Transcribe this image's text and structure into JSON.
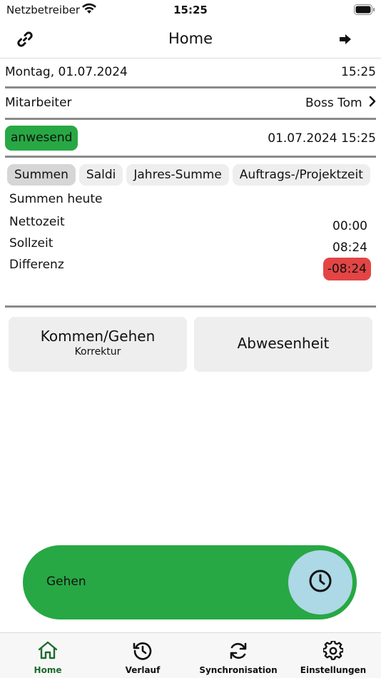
{
  "status_bar": {
    "carrier": "Netzbetreiber",
    "time": "15:25"
  },
  "nav": {
    "title": "Home"
  },
  "date_row": {
    "date": "Montag, 01.07.2024",
    "time": "15:25"
  },
  "employee_row": {
    "label": "Mitarbeiter",
    "value": "Boss Tom"
  },
  "status_row": {
    "badge": "anwesend",
    "timestamp": "01.07.2024 15:25",
    "badge_color": "#27a844"
  },
  "tabs": [
    {
      "label": "Summen"
    },
    {
      "label": "Saldi"
    },
    {
      "label": "Jahres-Summe"
    },
    {
      "label": "Auftrags-/Projektzeit"
    }
  ],
  "summary": {
    "title": "Summen heute",
    "rows": [
      {
        "label": "Nettozeit",
        "value": "00:00"
      },
      {
        "label": "Sollzeit",
        "value": "08:24"
      },
      {
        "label": "Differenz",
        "value": "-08:24"
      }
    ],
    "negative_color": "#e34545"
  },
  "buttons": {
    "kommen_gehen": {
      "label": "Kommen/Gehen",
      "sub": "Korrektur"
    },
    "abwesenheit": {
      "label": "Abwesenheit"
    }
  },
  "slider": {
    "label": "Gehen",
    "color": "#27a844",
    "knob_color": "#add8e6"
  },
  "tabbar": {
    "items": [
      {
        "label": "Home",
        "icon": "home-icon"
      },
      {
        "label": "Verlauf",
        "icon": "history-icon"
      },
      {
        "label": "Synchronisation",
        "icon": "sync-icon"
      },
      {
        "label": "Einstellungen",
        "icon": "gear-icon"
      }
    ],
    "active_color": "#1e6b2e"
  }
}
